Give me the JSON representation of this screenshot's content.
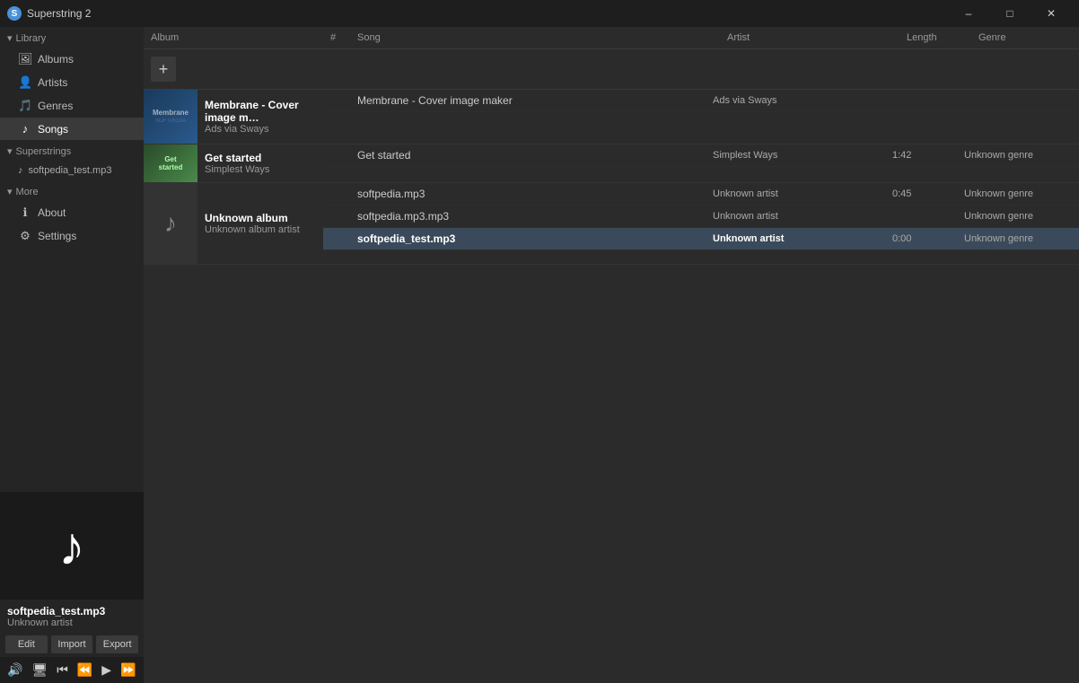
{
  "app": {
    "title": "Superstring 2",
    "icon": "S"
  },
  "titlebar": {
    "minimize": "–",
    "maximize": "□",
    "close": "✕"
  },
  "sidebar": {
    "library_label": "Library",
    "items": [
      {
        "id": "albums",
        "label": "Albums",
        "icon": "🖼"
      },
      {
        "id": "artists",
        "label": "Artists",
        "icon": "👤"
      },
      {
        "id": "genres",
        "label": "Genres",
        "icon": "🎵"
      },
      {
        "id": "songs",
        "label": "Songs",
        "icon": "♪"
      }
    ],
    "superstrings_label": "Superstrings",
    "files": [
      {
        "id": "file1",
        "label": "softpedia_test.mp3",
        "icon": "♪"
      }
    ],
    "more_label": "More",
    "more_items": [
      {
        "id": "about",
        "label": "About",
        "icon": "ℹ"
      },
      {
        "id": "settings",
        "label": "Settings",
        "icon": "⚙"
      }
    ]
  },
  "now_playing": {
    "title": "softpedia_test.mp3",
    "artist": "Unknown artist",
    "edit_label": "Edit",
    "import_label": "Import",
    "export_label": "Export"
  },
  "player": {
    "volume_icon": "🔊",
    "screen_icon": "🖥",
    "prev_icon": "⏮",
    "rewind_icon": "⏪",
    "play_icon": "▶",
    "forward_icon": "⏩",
    "next_icon": "⏭",
    "add_icon": "+",
    "star_icon": "★"
  },
  "table": {
    "headers": [
      "Album",
      "#",
      "Song",
      "Artist",
      "Length",
      "Genre"
    ],
    "add_button": "+"
  },
  "albums": [
    {
      "id": "membrane",
      "name": "Membrane - Cover image m…",
      "artist": "Ads via Sways",
      "thumb_label": "Membrane",
      "thumb_type": "membrane",
      "tracks": [
        {
          "num": "",
          "name": "Membrane - Cover image maker",
          "artist": "Ads via Sways",
          "length": "",
          "genre": ""
        }
      ]
    },
    {
      "id": "getstarted",
      "name": "Get started",
      "artist": "Simplest Ways",
      "thumb_label": "Get started",
      "thumb_type": "getstarted",
      "tracks": [
        {
          "num": "",
          "name": "Get started",
          "artist": "Simplest Ways",
          "length": "1:42",
          "genre": "Unknown genre"
        }
      ]
    },
    {
      "id": "unknown",
      "name": "Unknown album",
      "artist": "Unknown album artist",
      "thumb_label": "♪",
      "thumb_type": "unknown",
      "tracks": [
        {
          "num": "",
          "name": "softpedia.mp3",
          "artist": "Unknown artist",
          "length": "0:45",
          "genre": "Unknown genre",
          "bold": false
        },
        {
          "num": "",
          "name": "softpedia.mp3.mp3",
          "artist": "Unknown artist",
          "length": "",
          "genre": "Unknown genre",
          "bold": false
        },
        {
          "num": "",
          "name": "softpedia_test.mp3",
          "artist": "Unknown artist",
          "length": "0:00",
          "genre": "Unknown genre",
          "bold": true
        }
      ]
    }
  ]
}
